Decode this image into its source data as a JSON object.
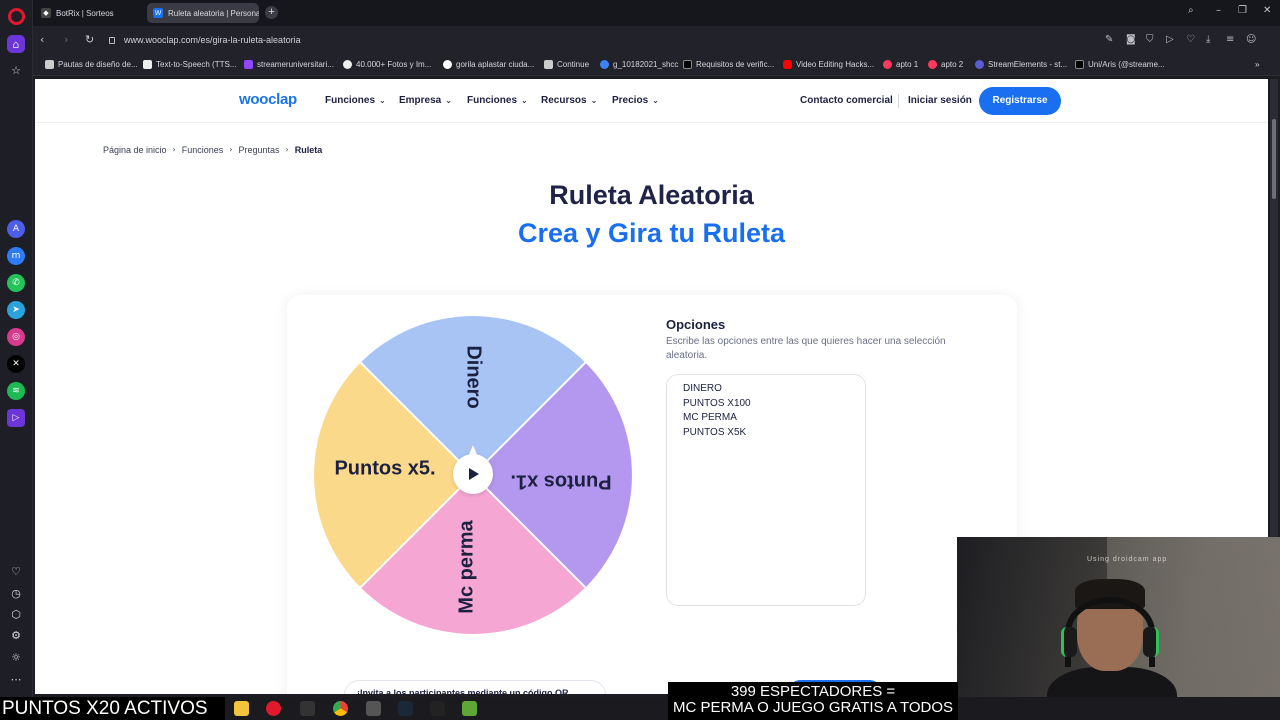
{
  "browser": {
    "tabs": [
      {
        "label": "BotRix | Sorteos",
        "active": false
      },
      {
        "label": "Ruleta aleatoria | Personal",
        "active": true
      }
    ],
    "url": "www.wooclap.com/es/gira-la-ruleta-aleatoria",
    "bookmarks": [
      "Pautas de diseño de...",
      "Text-to-Speech (TTS...",
      "streameruniversitari...",
      "40.000+ Fotos y Im...",
      "gorila aplastar ciuda...",
      "Continue",
      "g_10182021_shcc",
      "Requisitos de verific...",
      "Video Editing Hacks...",
      "apto 1",
      "apto 2",
      "StreamElements - st...",
      "Uni/Aris (@streame..."
    ]
  },
  "site": {
    "logo": "wooclap",
    "menu": [
      "Funciones",
      "Empresa",
      "Funciones",
      "Recursos",
      "Precios"
    ],
    "contact": "Contacto comercial",
    "login": "Iniciar sesión",
    "register": "Registrarse"
  },
  "breadcrumb": [
    "Página de inicio",
    "Funciones",
    "Preguntas",
    "Ruleta"
  ],
  "heading": {
    "title": "Ruleta Aleatoria",
    "subtitle": "Crea y Gira tu Ruleta"
  },
  "wheel": {
    "segments": [
      {
        "label": "Dinero",
        "color": "#a7c4f5"
      },
      {
        "label": "Puntos x1.",
        "color": "#b497ef"
      },
      {
        "label": "Mc perma",
        "color": "#f5a6d2"
      },
      {
        "label": "Puntos x5.",
        "color": "#fbd98a"
      }
    ]
  },
  "options": {
    "title": "Opciones",
    "description": "Escribe las opciones entre las que quieres hacer una selección aleatoria.",
    "items": [
      "DINERO",
      "PUNTOS X100",
      "MC PERMA",
      "PUNTOS X5K"
    ]
  },
  "invite_text": "¡Invita a los participantes mediante un código QR",
  "webcam_watermark": "Using droidcam app",
  "stream_overlay": {
    "left": "PUNTOS X20 ACTIVOS",
    "right_line1": "399 ESPECTADORES =",
    "right_line2": "MC PERMA O JUEGO GRATIS A TODOS"
  },
  "colors": {
    "brand": "#1a6ff0",
    "heading": "#1f2347",
    "opera_accent": "#6b35d8"
  }
}
